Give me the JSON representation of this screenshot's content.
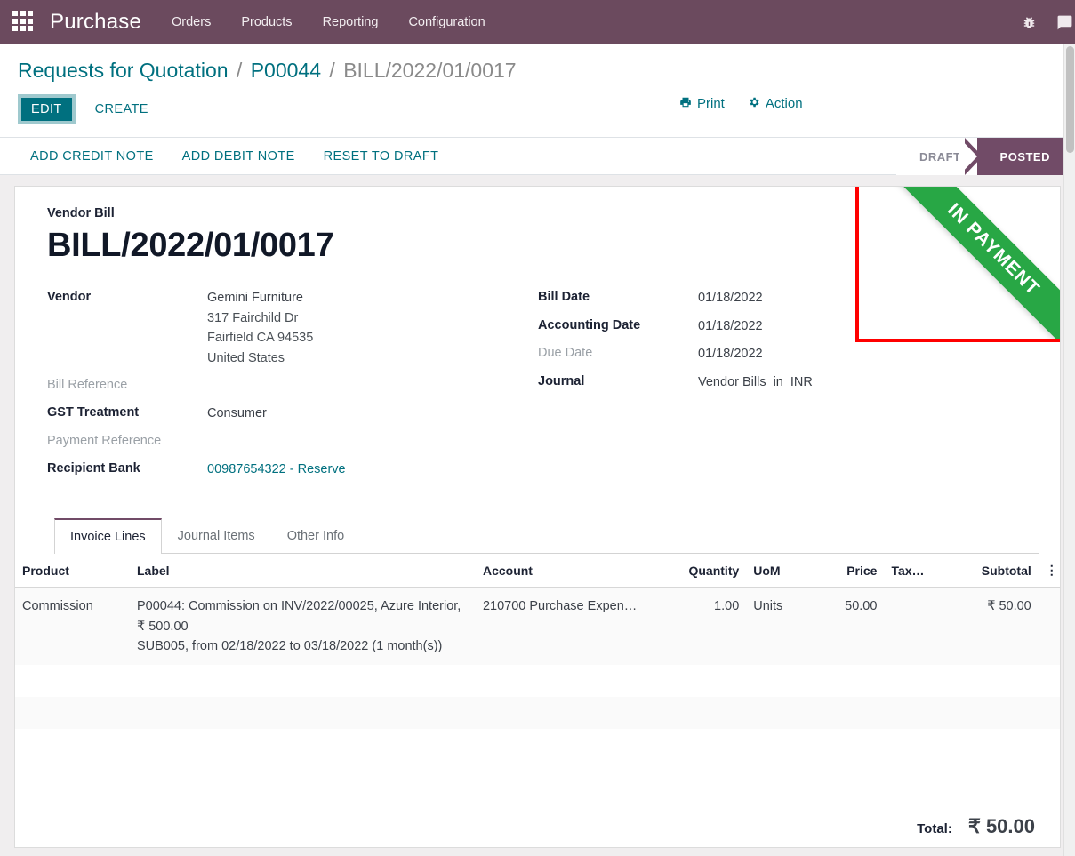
{
  "navbar": {
    "apps_icon": "apps-grid-icon",
    "brand": "Purchase",
    "menu": [
      {
        "label": "Orders"
      },
      {
        "label": "Products"
      },
      {
        "label": "Reporting"
      },
      {
        "label": "Configuration"
      }
    ],
    "right_icons": [
      {
        "name": "bug-icon",
        "glyph": "🐞"
      },
      {
        "name": "chat-icon",
        "glyph": "💬"
      }
    ],
    "bg_color": "#6B4A5E"
  },
  "breadcrumb": {
    "root": "Requests for Quotation",
    "sep1": "/",
    "parent": "P00044",
    "sep2": "/",
    "current": "BILL/2022/01/0017"
  },
  "controls": {
    "edit_label": "EDIT",
    "create_label": "CREATE",
    "print_label": "Print",
    "print_icon": "printer-icon",
    "action_label": "Action",
    "action_icon": "gear-icon",
    "accent_color": "#00707F"
  },
  "statusbar": {
    "buttons": [
      {
        "label": "ADD CREDIT NOTE"
      },
      {
        "label": "ADD DEBIT NOTE"
      },
      {
        "label": "RESET TO DRAFT"
      }
    ],
    "stages": [
      {
        "label": "DRAFT",
        "active": false
      },
      {
        "label": "POSTED",
        "active": true
      }
    ],
    "active_color": "#714B67"
  },
  "ribbon": {
    "label": "IN PAYMENT",
    "color": "#28a745",
    "highlight_border_color": "#ff0000"
  },
  "document": {
    "subtitle": "Vendor Bill",
    "title": "BILL/2022/01/0017"
  },
  "form": {
    "left": {
      "vendor_label": "Vendor",
      "vendor_name": "Gemini Furniture",
      "vendor_street": "317 Fairchild Dr",
      "vendor_city": "Fairfield CA 94535",
      "vendor_country": "United States",
      "bill_reference_label": "Bill Reference",
      "bill_reference_value": "",
      "gst_treatment_label": "GST Treatment",
      "gst_treatment_value": "Consumer",
      "payment_reference_label": "Payment Reference",
      "payment_reference_value": "",
      "recipient_bank_label": "Recipient Bank",
      "recipient_bank_value": "00987654322 - Reserve"
    },
    "right": {
      "bill_date_label": "Bill Date",
      "bill_date_value": "01/18/2022",
      "accounting_date_label": "Accounting Date",
      "accounting_date_value": "01/18/2022",
      "due_date_label": "Due Date",
      "due_date_value": "01/18/2022",
      "journal_label": "Journal",
      "journal_value": "Vendor Bills",
      "journal_in": "in",
      "journal_currency": "INR"
    }
  },
  "tabs": [
    {
      "label": "Invoice Lines",
      "active": true
    },
    {
      "label": "Journal Items",
      "active": false
    },
    {
      "label": "Other Info",
      "active": false
    }
  ],
  "lines_table": {
    "columns": [
      "Product",
      "Label",
      "Account",
      "Quantity",
      "UoM",
      "Price",
      "Tax…",
      "Subtotal"
    ],
    "optional_columns_icon": "vertical-dots-icon",
    "rows": [
      {
        "product": "Commission",
        "label_line1": "P00044: Commission on INV/2022/00025, Azure Interior, ₹ 500.00",
        "label_line2": "SUB005, from 02/18/2022 to 03/18/2022 (1 month(s))",
        "account": "210700 Purchase Expen…",
        "quantity": "1.00",
        "uom": "Units",
        "price": "50.00",
        "tax": "",
        "subtotal": "₹ 50.00"
      }
    ]
  },
  "totals": {
    "total_label": "Total:",
    "total_value": "₹ 50.00"
  }
}
